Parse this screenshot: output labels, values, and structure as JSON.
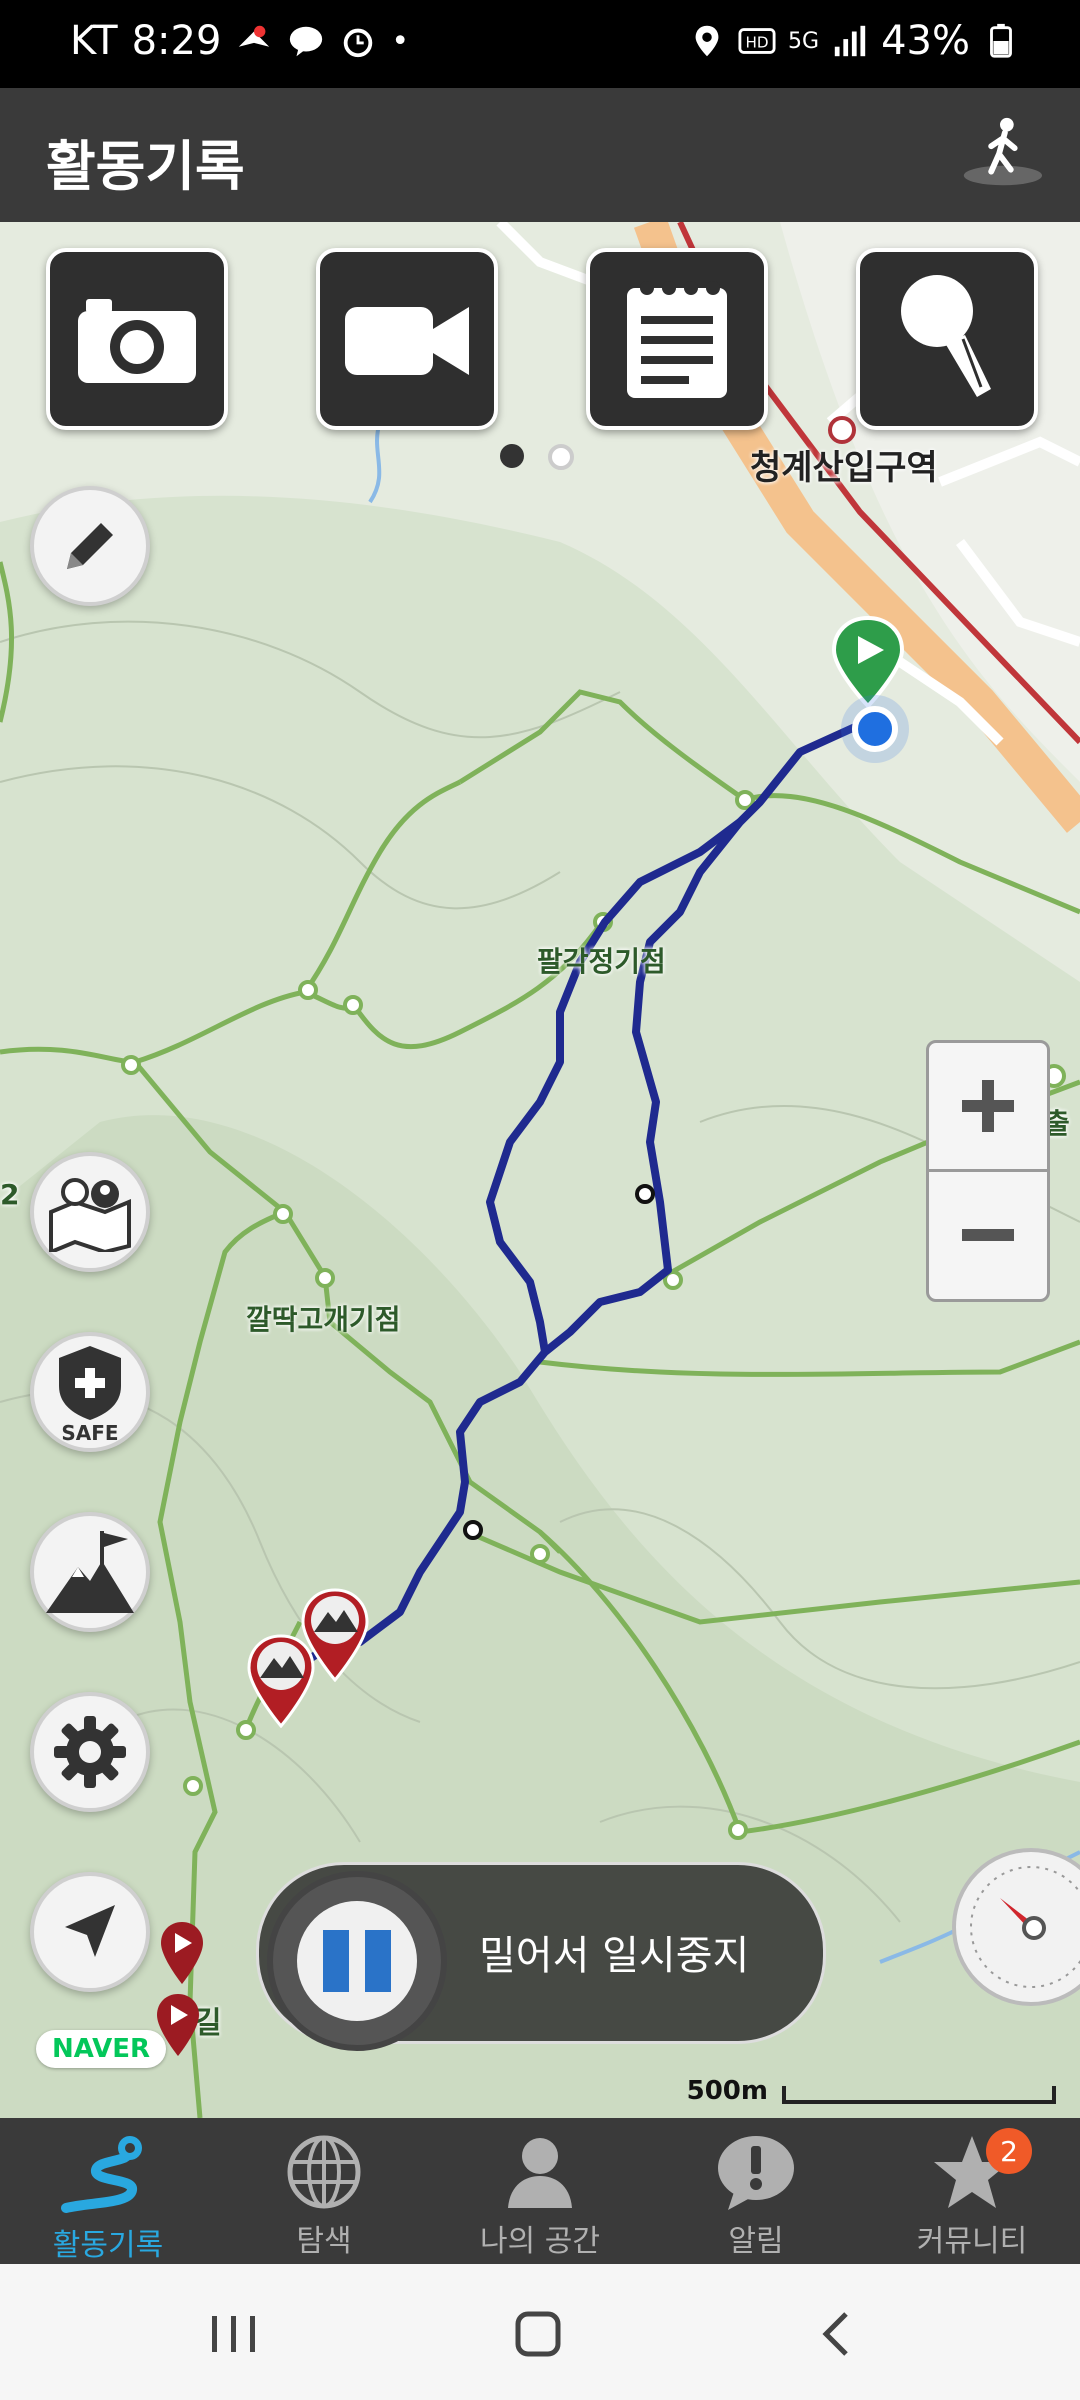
{
  "status_bar": {
    "carrier": "KT",
    "time": "8:29",
    "battery": "43%",
    "network": "5G"
  },
  "header": {
    "title": "활동기록"
  },
  "toolbar": {
    "buttons": [
      "camera",
      "video",
      "memo",
      "voice"
    ]
  },
  "map": {
    "labels": {
      "station": "청계산입구역",
      "peak1": "팔각정기점",
      "peak2": "깔딱고개기점",
      "exit": "출",
      "road": "2",
      "place_bottom": "길"
    },
    "scale": "500m",
    "naver": "NAVER"
  },
  "slider": {
    "label": "밀어서 일시중지"
  },
  "bottom_nav": {
    "tabs": [
      {
        "label": "활동기록"
      },
      {
        "label": "탐색"
      },
      {
        "label": "나의 공간"
      },
      {
        "label": "알림"
      },
      {
        "label": "커뮤니티"
      }
    ],
    "community_badge": "2"
  },
  "colors": {
    "header_bg": "#3a3a3a",
    "track": "#1f2a8f",
    "accent": "#29a8e0",
    "trail": "#7fb25a"
  }
}
